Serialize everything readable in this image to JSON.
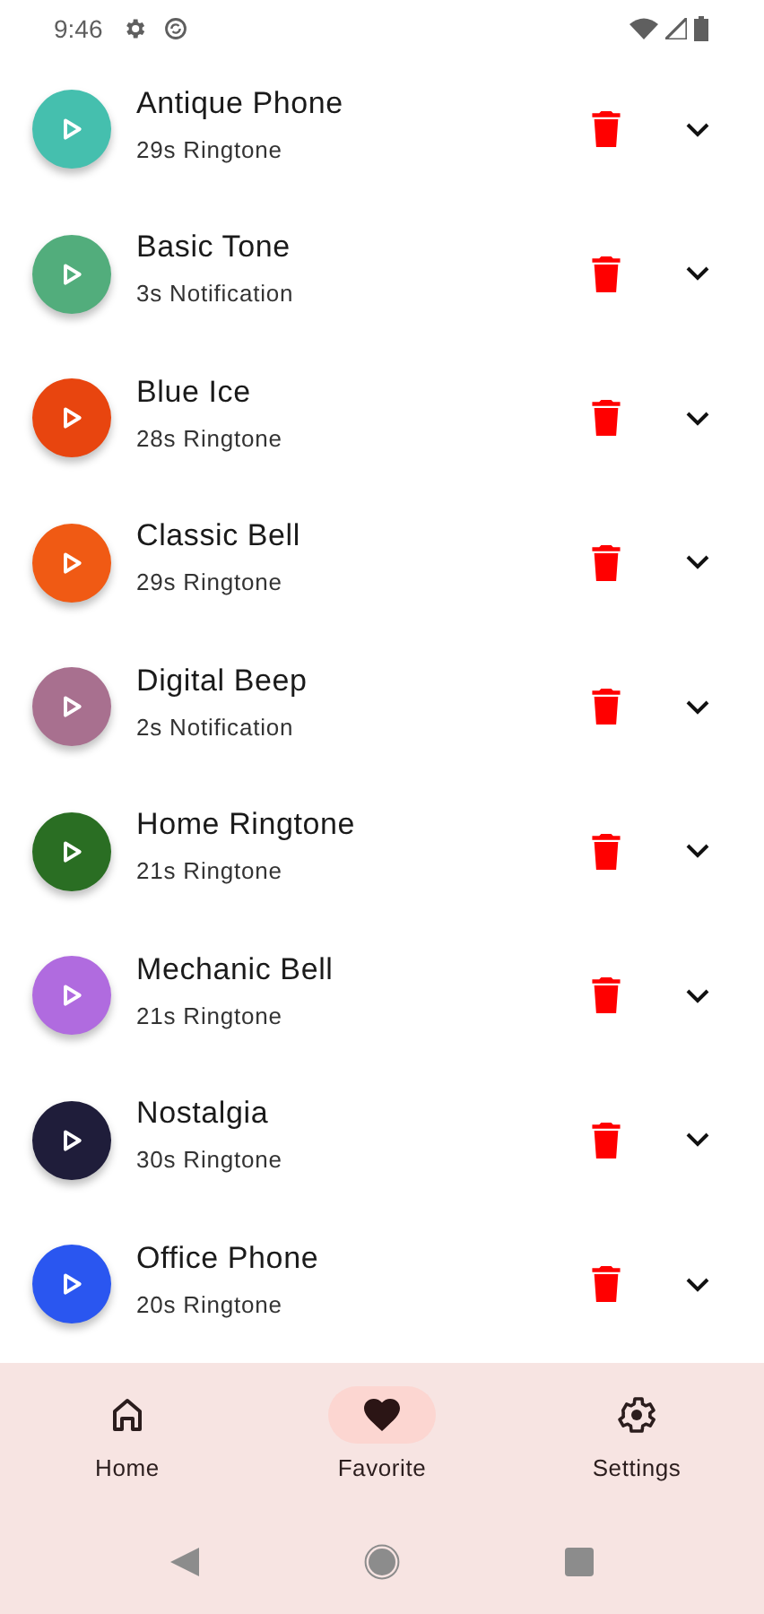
{
  "status_bar": {
    "time": "9:46"
  },
  "ringtones": [
    {
      "title": "Antique Phone",
      "subtitle": "29s Ringtone",
      "color": "#45bfae"
    },
    {
      "title": "Basic Tone",
      "subtitle": "3s Notification",
      "color": "#52ad7c"
    },
    {
      "title": "Blue Ice",
      "subtitle": "28s Ringtone",
      "color": "#e8450f"
    },
    {
      "title": "Classic Bell",
      "subtitle": "29s Ringtone",
      "color": "#f05a14"
    },
    {
      "title": "Digital Beep",
      "subtitle": "2s Notification",
      "color": "#a8708f"
    },
    {
      "title": "Home Ringtone",
      "subtitle": "21s Ringtone",
      "color": "#2a6e23"
    },
    {
      "title": "Mechanic Bell",
      "subtitle": "21s Ringtone",
      "color": "#b06bdf"
    },
    {
      "title": "Nostalgia",
      "subtitle": "30s Ringtone",
      "color": "#1f1d3a"
    },
    {
      "title": "Office Phone",
      "subtitle": "20s Ringtone",
      "color": "#2a56f0"
    }
  ],
  "bottom_nav": [
    {
      "label": "Home",
      "kind": "home",
      "selected": false
    },
    {
      "label": "Favorite",
      "kind": "heart",
      "selected": true
    },
    {
      "label": "Settings",
      "kind": "gear",
      "selected": false
    }
  ]
}
